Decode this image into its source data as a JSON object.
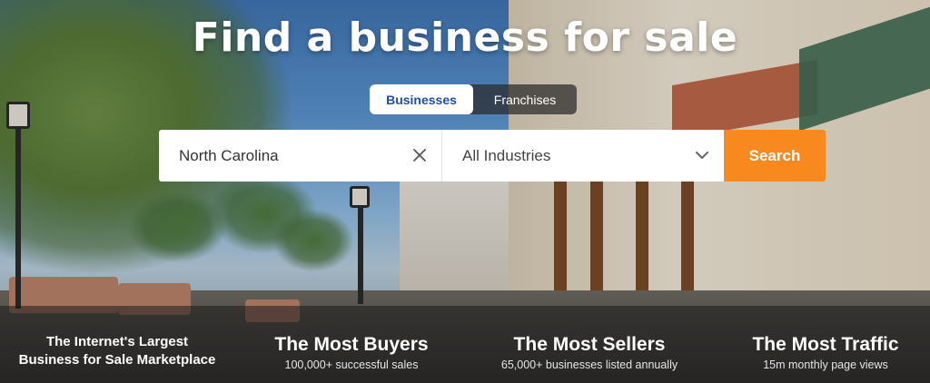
{
  "hero": {
    "title": "Find a business for sale"
  },
  "tabs": [
    {
      "label": "Businesses",
      "active": true
    },
    {
      "label": "Franchises",
      "active": false
    }
  ],
  "search": {
    "location_value": "North Carolina",
    "industry_value": "All Industries",
    "button_label": "Search"
  },
  "stats": {
    "marketplace_line1": "The Internet's Largest",
    "marketplace_line2": "Business for Sale Marketplace",
    "buyers_title": "The Most Buyers",
    "buyers_sub": "100,000+ successful sales",
    "sellers_title": "The Most Sellers",
    "sellers_sub": "65,000+ businesses listed annually",
    "traffic_title": "The Most Traffic",
    "traffic_sub": "15m monthly page views"
  },
  "icons": {
    "clear": "close-icon",
    "dropdown": "chevron-down-icon"
  },
  "colors": {
    "accent": "#f7891f",
    "tab_active_text": "#1f4fa0"
  }
}
